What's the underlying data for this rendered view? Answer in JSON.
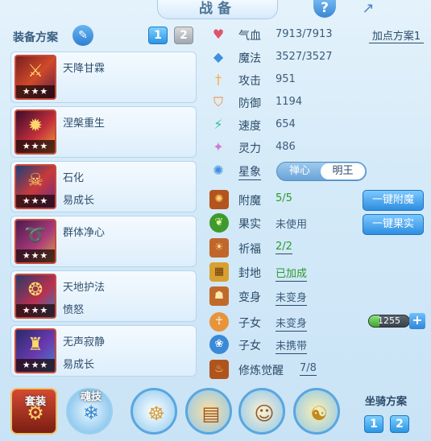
{
  "header": {
    "title": "战备",
    "help_icon": "?",
    "share_icon": "↗"
  },
  "equipment_plan": {
    "label": "装备方案",
    "tabs": [
      "1",
      "2"
    ]
  },
  "skills": [
    {
      "name": "天降甘霖",
      "sub": "",
      "stars": "★★★",
      "icon": "sword-icon"
    },
    {
      "name": "涅槃重生",
      "sub": "",
      "stars": "★★★",
      "icon": "phoenix-icon"
    },
    {
      "name": "石化",
      "sub": "易成长",
      "stars": "★★★",
      "icon": "monster-icon"
    },
    {
      "name": "群体净心",
      "sub": "",
      "stars": "★★★",
      "icon": "rope-icon"
    },
    {
      "name": "天地护法",
      "sub": "愤怒",
      "stars": "★★★",
      "icon": "guardian-icon"
    },
    {
      "name": "无声寂静",
      "sub": "易成长",
      "stars": "★★★",
      "icon": "armor-icon"
    }
  ],
  "stats": [
    {
      "label": "气血",
      "value": "7913/7913",
      "icon": "heart-icon",
      "color": "#e0536c"
    },
    {
      "label": "魔法",
      "value": "3527/3527",
      "icon": "diamond-icon",
      "color": "#3f8fe0"
    },
    {
      "label": "攻击",
      "value": "951",
      "icon": "sword-icon",
      "color": "#f0b23a"
    },
    {
      "label": "防御",
      "value": "1194",
      "icon": "shield-icon",
      "color": "#f0893a"
    },
    {
      "label": "速度",
      "value": "654",
      "icon": "lightning-icon",
      "color": "#2cc28f"
    },
    {
      "label": "灵力",
      "value": "486",
      "icon": "spirit-icon",
      "color": "#d07ad8"
    }
  ],
  "add_point_plan": "加点方案1",
  "star_sign": {
    "label": "星象",
    "options": [
      "禅心",
      "明王"
    ]
  },
  "enhancements": [
    {
      "label": "附魔",
      "value": "5/5",
      "status": "green",
      "icon": "enchant-icon"
    },
    {
      "label": "果实",
      "value": "未使用",
      "status": "plain",
      "icon": "fruit-icon"
    },
    {
      "label": "祈福",
      "value": "2/2",
      "status": "green",
      "icon": "bless-icon"
    },
    {
      "label": "封地",
      "value": "已加成",
      "status": "green",
      "icon": "fief-icon"
    },
    {
      "label": "变身",
      "value": "未变身",
      "status": "plain",
      "icon": "transform-icon"
    },
    {
      "label": "子女",
      "value": "未变身",
      "status": "plain",
      "icon": "child-icon"
    },
    {
      "label": "子女",
      "value": "未携带",
      "status": "plain",
      "icon": "paw-icon"
    },
    {
      "label": "修炼觉醒",
      "value": "7/8",
      "status": "plain",
      "icon": "cultivate-icon"
    }
  ],
  "buttons": {
    "one_click_enchant": "一键附魔",
    "one_click_fruit": "一键果实"
  },
  "exp": {
    "value": "1255",
    "fill": 0.25
  },
  "bottom": {
    "outfit": "套装",
    "soul_skill": "魂技",
    "mount_plan_label": "坐骑方案",
    "mount_tabs": [
      "1",
      "2"
    ]
  }
}
